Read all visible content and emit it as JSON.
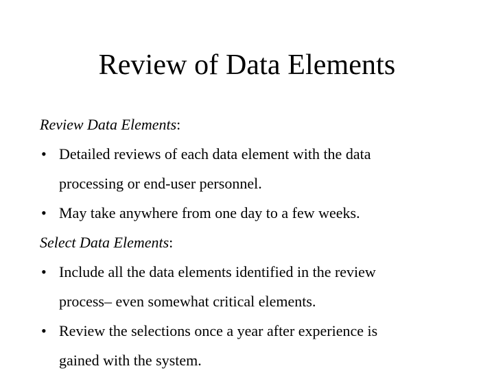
{
  "slide": {
    "title": "Review of Data Elements",
    "background_color": "#ffffff",
    "text_color": "#000000",
    "bullet_glyph": "•",
    "blocks": [
      {
        "kind": "heading",
        "text": "Review Data Elements",
        "colon": ":"
      },
      {
        "kind": "bullet",
        "line1": "Detailed reviews of each data element with the data",
        "line2": "processing or end-user personnel."
      },
      {
        "kind": "bullet",
        "line1": "May take anywhere from one day to a few weeks.",
        "line2": ""
      },
      {
        "kind": "heading",
        "text": "Select Data Elements",
        "colon": ":"
      },
      {
        "kind": "bullet",
        "line1": "Include all the data elements identified in the review",
        "line2": "process– even somewhat critical elements."
      },
      {
        "kind": "bullet",
        "line1": "Review the selections once a year after experience is",
        "line2": "gained with the system."
      }
    ]
  }
}
